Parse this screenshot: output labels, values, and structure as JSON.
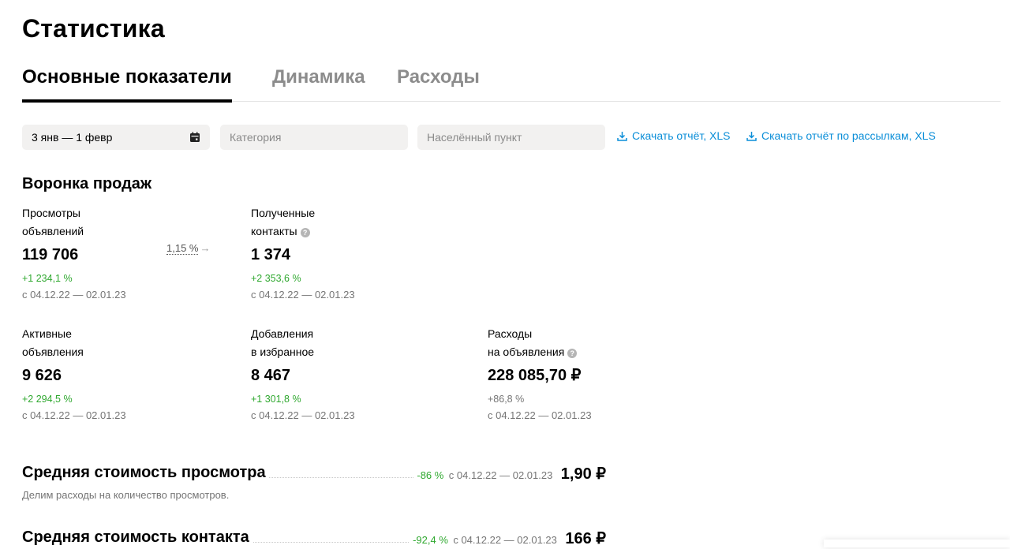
{
  "page_title": "Статистика",
  "tabs": [
    {
      "label": "Основные показатели",
      "active": true
    },
    {
      "label": "Динамика",
      "active": false
    },
    {
      "label": "Расходы",
      "active": false
    }
  ],
  "filters": {
    "date_range": "3 янв — 1 февр",
    "category_placeholder": "Категория",
    "location_placeholder": "Населённый пункт"
  },
  "downloads": {
    "report_xls": "Скачать отчёт, XLS",
    "mailings_xls": "Скачать отчёт по рассылкам, XLS"
  },
  "funnel": {
    "title": "Воронка продаж",
    "conversion": "1,15 %",
    "metrics": [
      {
        "label_line1": "Просмотры",
        "label_line2": "объявлений",
        "value": "119 706",
        "delta": "+1 234,1 %",
        "period": "с 04.12.22 — 02.01.23",
        "help": false
      },
      {
        "label_line1": "Полученные",
        "label_line2": "контакты",
        "value": "1 374",
        "delta": "+2 353,6 %",
        "period": "с 04.12.22 — 02.01.23",
        "help": true
      },
      {
        "label_line1": "Активные",
        "label_line2": "объявления",
        "value": "9 626",
        "delta": "+2 294,5 %",
        "period": "с 04.12.22 — 02.01.23",
        "help": false
      },
      {
        "label_line1": "Добавления",
        "label_line2": "в избранное",
        "value": "8 467",
        "delta": "+1 301,8 %",
        "period": "с 04.12.22 — 02.01.23",
        "help": false
      },
      {
        "label_line1": "Расходы",
        "label_line2": "на объявления",
        "value": "228 085,70 ₽",
        "delta": "+86,8 %",
        "period": "с 04.12.22 — 02.01.23",
        "help": true
      }
    ]
  },
  "averages": [
    {
      "title": "Средняя стоимость просмотра",
      "delta": "-86 %",
      "period": "с 04.12.22 — 02.01.23",
      "value": "1,90 ₽",
      "description": "Делим расходы на количество просмотров."
    },
    {
      "title": "Средняя стоимость контакта",
      "delta": "-92,4 %",
      "period": "с 04.12.22 — 02.01.23",
      "value": "166 ₽"
    }
  ],
  "colors": {
    "link": "#0a8ed8",
    "positive": "#2fa82f",
    "muted": "#757575"
  }
}
